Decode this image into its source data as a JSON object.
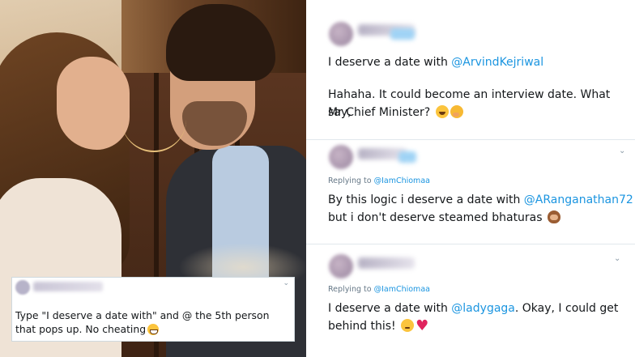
{
  "left_panel": {
    "overlay_tweet": {
      "text": "Type \"I deserve a date with\" and @ the 5th person that pops up. No cheating",
      "emoji": "grinning-face-emoji"
    }
  },
  "right_panel": {
    "tweet1": {
      "line1_prefix": "I deserve a date with ",
      "line1_mention": "@ArvindKejriwal",
      "line2": "Hahaha. It could become an interview date. What say,",
      "line3": "Mr Chief Minister?",
      "emojis": [
        "laughing-face-emoji",
        "face-with-hand-over-mouth-emoji"
      ]
    },
    "tweet2": {
      "reply_prefix": "Replying to ",
      "reply_mention": "@IamChiomaa",
      "line1_prefix": "By this logic i deserve a date with ",
      "line1_mention": "@ARanganathan72",
      "line2": "but i don't deserve steamed bhaturas",
      "emojis": [
        "see-no-evil-monkey-emoji"
      ]
    },
    "tweet3": {
      "reply_prefix": "Replying to ",
      "reply_mention": "@IamChiomaa",
      "line1_prefix": "I deserve a date with ",
      "line1_mention": "@ladygaga",
      "line1_suffix": ". Okay, I could get",
      "line2": "behind this!",
      "emojis": [
        "relieved-face-emoji",
        "red-heart-emoji"
      ]
    }
  },
  "colors": {
    "mention": "#1b95e0",
    "text": "#14171a",
    "muted": "#657786",
    "divider": "#e1e8ed"
  }
}
